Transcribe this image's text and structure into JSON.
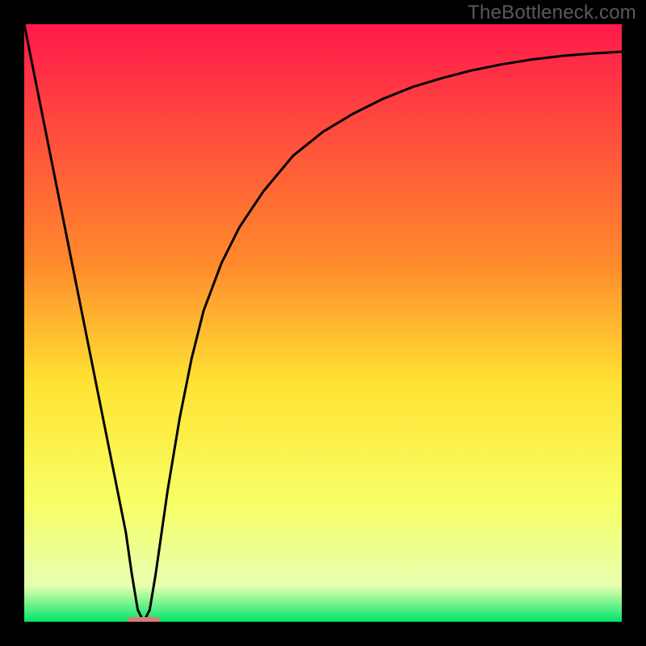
{
  "watermark": "TheBottleneck.com",
  "chart_data": {
    "type": "line",
    "title": "",
    "xlabel": "",
    "ylabel": "",
    "xlim": [
      0,
      100
    ],
    "ylim": [
      0,
      100
    ],
    "background_gradient": {
      "stops": [
        {
          "offset": 0.0,
          "color": "#ff1a4b"
        },
        {
          "offset": 0.4,
          "color": "#ff8a2c"
        },
        {
          "offset": 0.6,
          "color": "#ffe233"
        },
        {
          "offset": 0.8,
          "color": "#f8ff66"
        },
        {
          "offset": 0.94,
          "color": "#e6ffb0"
        },
        {
          "offset": 1.0,
          "color": "#00e56a"
        }
      ]
    },
    "series": [
      {
        "name": "bottleneck-curve",
        "x": [
          0,
          5,
          10,
          15,
          17,
          18,
          19,
          20,
          21,
          22,
          23,
          24,
          26,
          28,
          30,
          33,
          36,
          40,
          45,
          50,
          55,
          60,
          65,
          70,
          75,
          80,
          85,
          90,
          95,
          100
        ],
        "y": [
          100,
          75,
          50,
          25,
          15,
          8,
          2,
          0,
          2,
          8,
          15,
          22,
          34,
          44,
          52,
          60,
          66,
          72,
          78,
          82,
          85,
          87.5,
          89.5,
          91,
          92.3,
          93.3,
          94.1,
          94.7,
          95.1,
          95.4
        ]
      }
    ],
    "marker": {
      "name": "optimum-marker",
      "x_center": 20,
      "x_halfwidth": 2.8,
      "y": 0,
      "color": "#d97a7a",
      "height_frac": 0.016
    },
    "colors": {
      "curve": "#000000",
      "frame": "#000000"
    }
  }
}
